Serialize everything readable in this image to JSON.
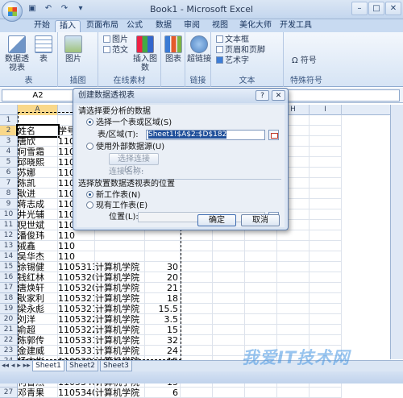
{
  "window": {
    "title": "Book1 - Microsoft Excel"
  },
  "ribbon_tabs": [
    "开始",
    "插入",
    "页面布局",
    "公式",
    "数据",
    "审阅",
    "视图",
    "美化大师",
    "开发工具"
  ],
  "ribbon": {
    "groups": {
      "tables": {
        "label": "表",
        "pivot": "数据透视表",
        "table": "表"
      },
      "illustrations": {
        "label": "插图",
        "picture": "图片"
      },
      "online": {
        "label": "在线素材",
        "pictures": "图片",
        "templates": "范文",
        "insert_picture": "插入图数"
      },
      "charts": {
        "label": "",
        "chart": "图表"
      },
      "links": {
        "label": "链接",
        "hyperlink": "超链接"
      },
      "text": {
        "label": "文本",
        "textbox": "文本框",
        "header": "页眉和页脚",
        "wordart": "艺术字"
      },
      "symbols": {
        "label": "特殊符号",
        "symbol": "符号"
      }
    }
  },
  "formula_bar": {
    "name_box": "A2"
  },
  "columns": [
    "A",
    "B",
    "C",
    "D",
    "E",
    "F",
    "G",
    "H",
    "I"
  ],
  "rows": [
    {
      "n": "1",
      "a": "",
      "b": "",
      "c": "",
      "d": ""
    },
    {
      "n": "2",
      "a": "姓名",
      "b": "学号",
      "c": "",
      "d": ""
    },
    {
      "n": "3",
      "a": "唐欣",
      "b": "110",
      "c": "",
      "d": ""
    },
    {
      "n": "4",
      "a": "何雪霜",
      "b": "110",
      "c": "",
      "d": ""
    },
    {
      "n": "5",
      "a": "邱晓熙",
      "b": "110",
      "c": "",
      "d": ""
    },
    {
      "n": "6",
      "a": "苏娜",
      "b": "110",
      "c": "",
      "d": ""
    },
    {
      "n": "7",
      "a": "陈凯",
      "b": "110",
      "c": "",
      "d": ""
    },
    {
      "n": "8",
      "a": "耿进",
      "b": "110",
      "c": "",
      "d": ""
    },
    {
      "n": "9",
      "a": "蒋志成",
      "b": "110",
      "c": "",
      "d": ""
    },
    {
      "n": "10",
      "a": "井光辅",
      "b": "110",
      "c": "",
      "d": ""
    },
    {
      "n": "11",
      "a": "倪世斌",
      "b": "110",
      "c": "",
      "d": ""
    },
    {
      "n": "12",
      "a": "潘俊玮",
      "b": "110",
      "c": "",
      "d": ""
    },
    {
      "n": "13",
      "a": "戚鑫",
      "b": "110",
      "c": "",
      "d": ""
    },
    {
      "n": "14",
      "a": "吴华杰",
      "b": "110",
      "c": "",
      "d": ""
    },
    {
      "n": "15",
      "a": "徐锡健",
      "b": "11053130",
      "c": "计算机学院",
      "d": "30"
    },
    {
      "n": "16",
      "a": "钱红林",
      "b": "11053201",
      "c": "计算机学院",
      "d": "20"
    },
    {
      "n": "17",
      "a": "唐焕轩",
      "b": "11053205",
      "c": "计算机学院",
      "d": "21"
    },
    {
      "n": "18",
      "a": "耿家利",
      "b": "11053212",
      "c": "计算机学院",
      "d": "18"
    },
    {
      "n": "19",
      "a": "梁永彪",
      "b": "11053219",
      "c": "计算机学院",
      "d": "15.5"
    },
    {
      "n": "20",
      "a": "刘洋",
      "b": "11053222",
      "c": "计算机学院",
      "d": "3.5"
    },
    {
      "n": "21",
      "a": "俞超",
      "b": "11053226",
      "c": "计算机学院",
      "d": "15"
    },
    {
      "n": "22",
      "a": "陈郭传",
      "b": "11053310",
      "c": "计算机学院",
      "d": "32"
    },
    {
      "n": "23",
      "a": "金建威",
      "b": "11053316",
      "c": "计算机学院",
      "d": "24"
    },
    {
      "n": "24",
      "a": "杨立彬",
      "b": "11053324",
      "c": "计算机学院",
      "d": "15"
    },
    {
      "n": "25",
      "a": "方奔奔",
      "b": "11053402",
      "c": "计算机学院",
      "d": "19"
    },
    {
      "n": "26",
      "a": "何鲁燕",
      "b": "11053403",
      "c": "计算机学院",
      "d": "15"
    },
    {
      "n": "27",
      "a": "邓青果",
      "b": "11053408",
      "c": "计算机学院",
      "d": "6"
    }
  ],
  "sheets": [
    "Sheet1",
    "Sheet2",
    "Sheet3"
  ],
  "dialog": {
    "title": "创建数据透视表",
    "section1": "请选择要分析的数据",
    "option_select_range": "选择一个表或区域(S)",
    "range_label": "表/区域(T):",
    "range_value": "Sheet1!$A$2:$D$182",
    "option_external": "使用外部数据源(U)",
    "choose_connection": "选择连接(C)...",
    "connection_name": "连接名称:",
    "section2": "选择放置数据透视表的位置",
    "option_new_sheet": "新工作表(N)",
    "option_existing_sheet": "现有工作表(E)",
    "location_label": "位置(L):",
    "ok": "确定",
    "cancel": "取消"
  },
  "watermark": "我爱IT技术网"
}
